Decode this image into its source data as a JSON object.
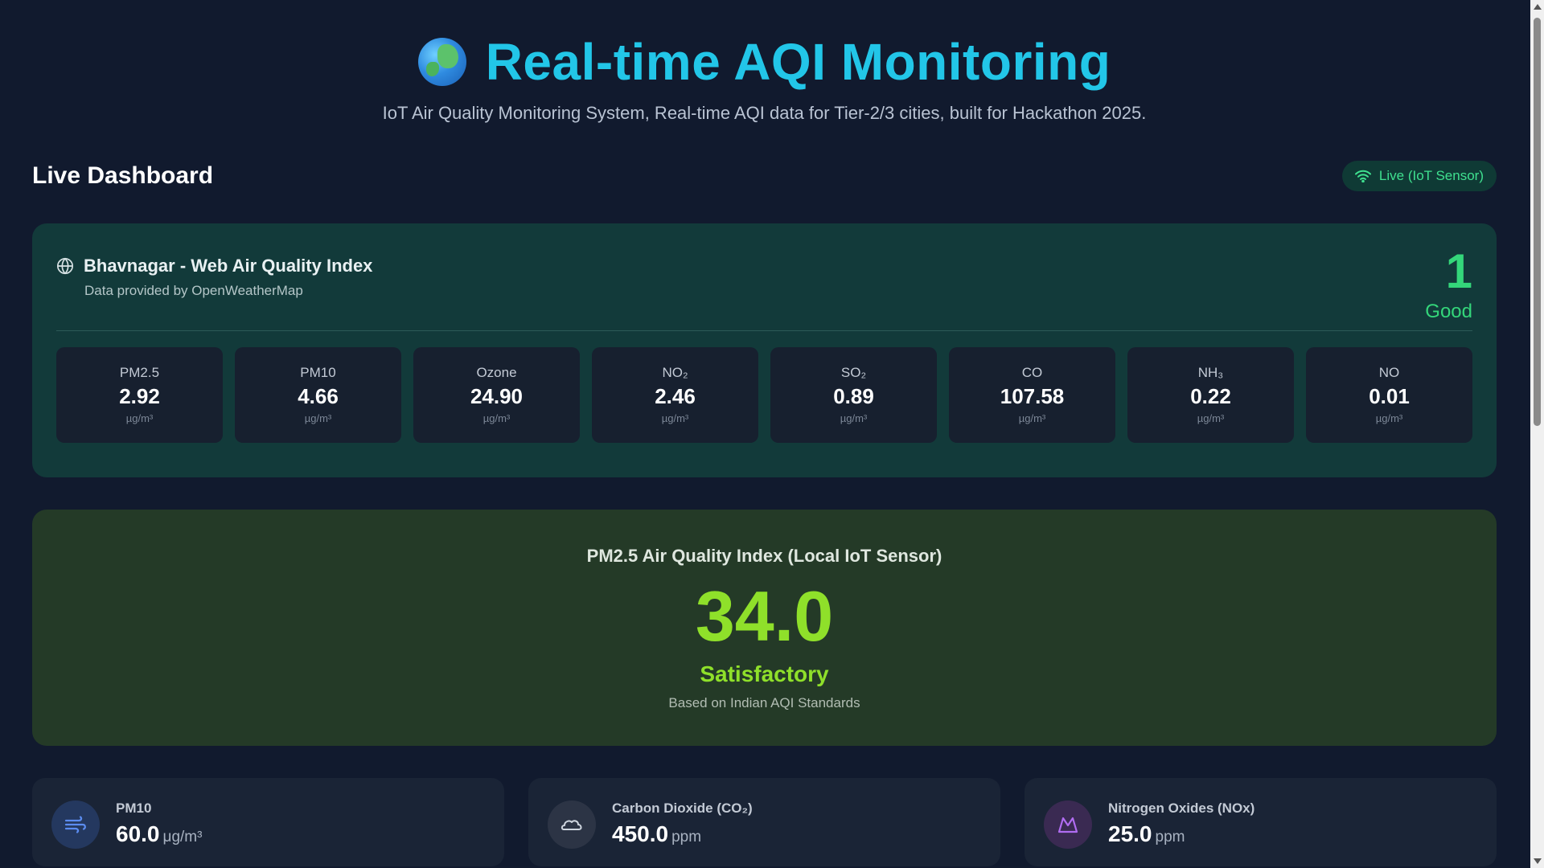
{
  "header": {
    "title": "Real-time AQI Monitoring",
    "subtitle": "IoT Air Quality Monitoring System, Real-time AQI data for Tier-2/3 cities, built for Hackathon 2025."
  },
  "dashboard": {
    "title": "Live Dashboard",
    "live_badge": "Live (IoT Sensor)"
  },
  "web_aqi": {
    "title": "Bhavnagar - Web Air Quality Index",
    "source": "Data provided by OpenWeatherMap",
    "aqi_value": "1",
    "aqi_label": "Good",
    "pollutants": [
      {
        "name": "PM2.5",
        "value": "2.92",
        "unit": "µg/m³"
      },
      {
        "name": "PM10",
        "value": "4.66",
        "unit": "µg/m³"
      },
      {
        "name": "Ozone",
        "value": "24.90",
        "unit": "µg/m³"
      },
      {
        "name": "NO₂",
        "value": "2.46",
        "unit": "µg/m³"
      },
      {
        "name": "SO₂",
        "value": "0.89",
        "unit": "µg/m³"
      },
      {
        "name": "CO",
        "value": "107.58",
        "unit": "µg/m³"
      },
      {
        "name": "NH₃",
        "value": "0.22",
        "unit": "µg/m³"
      },
      {
        "name": "NO",
        "value": "0.01",
        "unit": "µg/m³"
      }
    ]
  },
  "local_iot": {
    "title": "PM2.5 Air Quality Index (Local IoT Sensor)",
    "value": "34.0",
    "status": "Satisfactory",
    "note": "Based on Indian AQI Standards"
  },
  "metrics": [
    {
      "label": "PM10",
      "value": "60.0",
      "unit": "μg/m³",
      "icon": "wind-icon",
      "color": "#5b8cf0"
    },
    {
      "label": "Carbon Dioxide (CO₂)",
      "value": "450.0",
      "unit": "ppm",
      "icon": "cloud-icon",
      "color": "#cfd6e0"
    },
    {
      "label": "Nitrogen Oxides (NOx)",
      "value": "25.0",
      "unit": "ppm",
      "icon": "mountain-icon",
      "color": "#b06cf0"
    }
  ],
  "colors": {
    "title_accent": "#22c6e8",
    "good": "#34d67a",
    "satisfactory": "#8fe02a"
  }
}
